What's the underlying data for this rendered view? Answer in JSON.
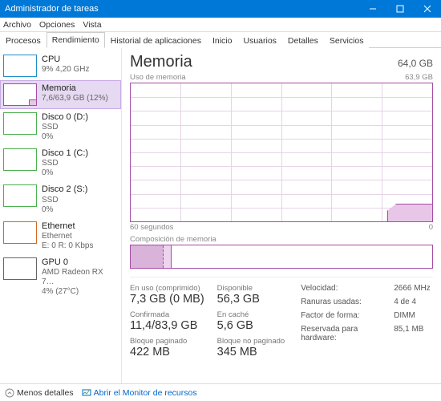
{
  "window": {
    "title": "Administrador de tareas"
  },
  "menubar": [
    "Archivo",
    "Opciones",
    "Vista"
  ],
  "tabs": [
    "Procesos",
    "Rendimiento",
    "Historial de aplicaciones",
    "Inicio",
    "Usuarios",
    "Detalles",
    "Servicios"
  ],
  "active_tab": 1,
  "sidebar": {
    "items": [
      {
        "name": "CPU",
        "sub1": "9%  4,20 GHz",
        "kind": "cpu"
      },
      {
        "name": "Memoria",
        "sub1": "7,6/63,9 GB (12%)",
        "kind": "mem",
        "active": true
      },
      {
        "name": "Disco 0 (D:)",
        "sub1": "SSD",
        "sub2": "0%",
        "kind": "disk"
      },
      {
        "name": "Disco 1 (C:)",
        "sub1": "SSD",
        "sub2": "0%",
        "kind": "disk"
      },
      {
        "name": "Disco 2 (S:)",
        "sub1": "SSD",
        "sub2": "0%",
        "kind": "disk"
      },
      {
        "name": "Ethernet",
        "sub1": "Ethernet",
        "sub2": "E: 0  R: 0 Kbps",
        "kind": "eth"
      },
      {
        "name": "GPU 0",
        "sub1": "AMD Radeon RX 7…",
        "sub2": "4% (27°C)",
        "kind": "gpu"
      }
    ]
  },
  "main": {
    "title": "Memoria",
    "capacity": "64,0 GB",
    "usage_label": "Uso de memoria",
    "ymax_label": "63,9 GB",
    "x_left": "60 segundos",
    "x_right": "0",
    "comp_label": "Composición de memoria",
    "stats_left": [
      {
        "l": "En uso (comprimido)",
        "v": "7,3 GB (0 MB)"
      },
      {
        "l": "Confirmada",
        "v": "11,4/83,9 GB"
      },
      {
        "l": "Bloque paginado",
        "v": "422 MB"
      }
    ],
    "stats_mid": [
      {
        "l": "Disponible",
        "v": "56,3 GB"
      },
      {
        "l": "En caché",
        "v": "5,6 GB"
      },
      {
        "l": "Bloque no paginado",
        "v": "345 MB"
      }
    ],
    "stats_right": [
      {
        "k": "Velocidad:",
        "v": "2666 MHz"
      },
      {
        "k": "Ranuras usadas:",
        "v": "4 de 4"
      },
      {
        "k": "Factor de forma:",
        "v": "DIMM"
      },
      {
        "k": "Reservada para hardware:",
        "v": "85,1 MB"
      }
    ]
  },
  "footer": {
    "less_details": "Menos detalles",
    "resource_monitor": "Abrir el Monitor de recursos"
  },
  "chart_data": {
    "type": "area",
    "title": "Uso de memoria",
    "xlabel": "segundos",
    "ylabel": "GB",
    "xlim": [
      60,
      0
    ],
    "ylim": [
      0,
      63.9
    ],
    "series": [
      {
        "name": "En uso",
        "x": [
          60,
          50,
          40,
          30,
          20,
          10,
          5,
          0
        ],
        "values": [
          0,
          0,
          0,
          0,
          0,
          0,
          6.8,
          7.6
        ]
      }
    ]
  }
}
